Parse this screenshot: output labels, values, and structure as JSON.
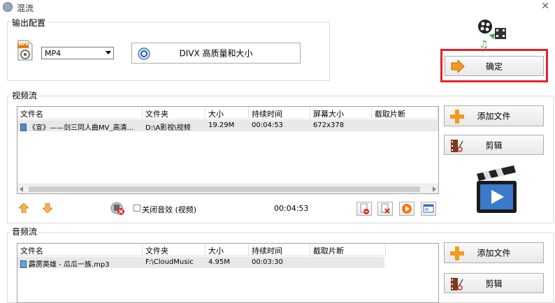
{
  "window": {
    "title": "混流",
    "close_glyph": "✕"
  },
  "output_config": {
    "label": "输出配置",
    "format": "MP4",
    "format_icon_text": "MP4",
    "profile": "DIVX 高质量和大小"
  },
  "confirm_button": {
    "label": "确定"
  },
  "video_stream": {
    "label": "视频流",
    "columns": [
      "文件名",
      "文件夹",
      "大小",
      "持续时间",
      "屏幕大小",
      "截取片断"
    ],
    "rows": [
      {
        "name": "《宣》——剑三同人曲MV_高清...",
        "folder": "D:\\A影视\\视频",
        "size": "19.29M",
        "duration": "00:04:53",
        "screen": "672x378",
        "clip": ""
      }
    ],
    "mute_label": "关闭音效 (视频)",
    "total_duration": "00:04:53",
    "add_button": "添加文件",
    "clip_button": "剪辑"
  },
  "audio_stream": {
    "label": "音频流",
    "columns": [
      "文件名",
      "文件夹",
      "大小",
      "持续时间",
      "截取片断"
    ],
    "rows": [
      {
        "name": "霹雳英雄 - 瓜瓜一族.mp3",
        "folder": "F:\\CloudMusic",
        "size": "4.95M",
        "duration": "00:03:30",
        "clip": ""
      }
    ],
    "add_button": "添加文件",
    "clip_button": "剪辑"
  },
  "colors": {
    "highlight_border": "#e8202a",
    "accent_orange": "#f39a1e"
  }
}
